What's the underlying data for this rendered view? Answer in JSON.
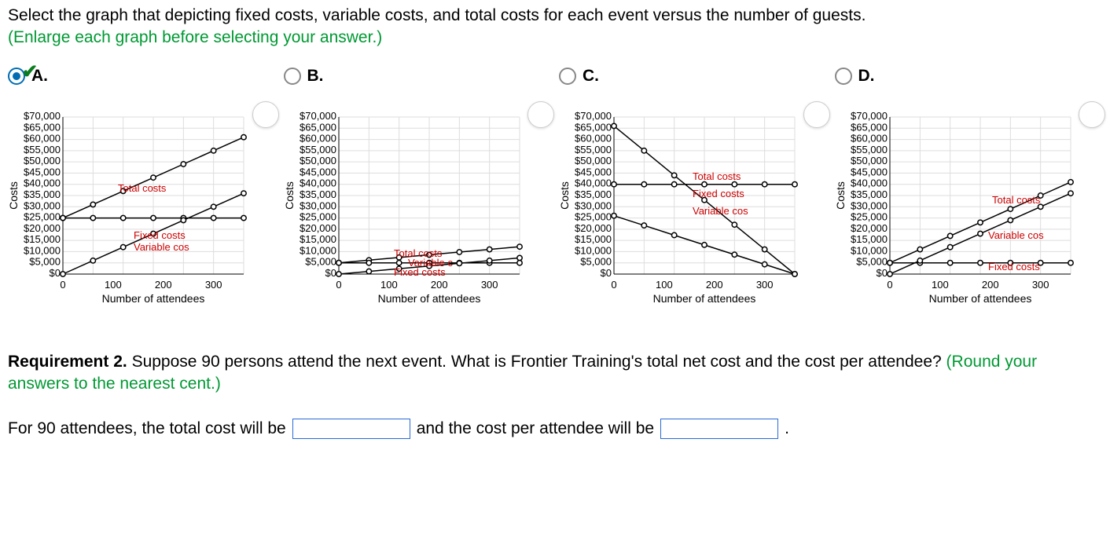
{
  "question": {
    "prompt": "Select the graph that depicting fixed costs, variable costs, and total costs for each event versus the number of guests.",
    "note": "(Enlarge each graph before selecting your answer.)"
  },
  "options": [
    {
      "key": "A",
      "label": "A.",
      "selected": true,
      "correct": true
    },
    {
      "key": "B",
      "label": "B.",
      "selected": false,
      "correct": false
    },
    {
      "key": "C",
      "label": "C.",
      "selected": false,
      "correct": false
    },
    {
      "key": "D",
      "label": "D.",
      "selected": false,
      "correct": false
    }
  ],
  "chart_common": {
    "x_label": "Number of attendees",
    "y_label": "Costs",
    "x_ticks": [
      "0",
      "100",
      "200",
      "300"
    ],
    "y_ticks": [
      "$0",
      "$5,000",
      "$10,000",
      "$15,000",
      "$20,000",
      "$25,000",
      "$30,000",
      "$35,000",
      "$40,000",
      "$45,000",
      "$50,000",
      "$55,000",
      "$60,000",
      "$65,000",
      "$70,000"
    ],
    "y_max": 70000,
    "x_max": 360,
    "x_points": [
      0,
      60,
      120,
      180,
      240,
      300,
      360
    ]
  },
  "chart_data": [
    {
      "type": "line",
      "option": "A",
      "legend": {
        "total": "Total costs",
        "fixed": "Fixed costs",
        "variable": "Variable cos"
      },
      "series": [
        {
          "name": "total",
          "values": [
            25000,
            31000,
            37000,
            43000,
            49000,
            55000,
            61000
          ]
        },
        {
          "name": "fixed",
          "values": [
            25000,
            25000,
            25000,
            25000,
            25000,
            25000,
            25000
          ]
        },
        {
          "name": "variable",
          "values": [
            0,
            6000,
            12000,
            18000,
            24000,
            30000,
            36000
          ]
        }
      ],
      "legend_pos": {
        "total": [
          130,
          95
        ],
        "fixed": [
          150,
          155
        ],
        "variable": [
          150,
          170
        ]
      }
    },
    {
      "type": "line",
      "option": "B",
      "legend": {
        "total": "Total costs",
        "fixed": "Fixed costs",
        "variable": "Variable c"
      },
      "series": [
        {
          "name": "total",
          "values": [
            5000,
            6200,
            7400,
            8600,
            9800,
            11000,
            12200
          ]
        },
        {
          "name": "fixed",
          "values": [
            5000,
            5000,
            5000,
            5000,
            5000,
            5000,
            5000
          ]
        },
        {
          "name": "variable",
          "values": [
            0,
            1200,
            2400,
            3600,
            4800,
            6000,
            7200
          ]
        }
      ],
      "legend_pos": {
        "total": [
          130,
          178
        ],
        "variable": [
          148,
          190
        ],
        "fixed": [
          130,
          202
        ]
      }
    },
    {
      "type": "line",
      "option": "C",
      "legend": {
        "total": "Total costs",
        "fixed": "Fixed costs",
        "variable": "Variable cos"
      },
      "series": [
        {
          "name": "total",
          "values": [
            66000,
            55000,
            44000,
            33000,
            22000,
            11000,
            0
          ]
        },
        {
          "name": "fixed",
          "values": [
            40000,
            40000,
            40000,
            40000,
            40000,
            40000,
            40000
          ]
        },
        {
          "name": "variable",
          "values": [
            26000,
            21667,
            17333,
            13000,
            8667,
            4333,
            0
          ]
        }
      ],
      "legend_pos": {
        "total": [
          160,
          80
        ],
        "fixed": [
          160,
          102
        ],
        "variable": [
          160,
          124
        ]
      }
    },
    {
      "type": "line",
      "option": "D",
      "legend": {
        "total": "Total costs",
        "fixed": "Fixed costs",
        "variable": "Variable cos"
      },
      "series": [
        {
          "name": "fixed",
          "values": [
            5000,
            5000,
            5000,
            5000,
            5000,
            5000,
            5000
          ]
        },
        {
          "name": "variable",
          "values": [
            0,
            6000,
            12000,
            18000,
            24000,
            30000,
            36000
          ]
        },
        {
          "name": "total",
          "values": [
            5000,
            11000,
            17000,
            23000,
            29000,
            35000,
            41000
          ]
        }
      ],
      "legend_pos": {
        "total": [
          190,
          110
        ],
        "variable": [
          185,
          155
        ],
        "fixed": [
          185,
          195
        ]
      }
    }
  ],
  "requirement2": {
    "label": "Requirement 2.",
    "text": "Suppose 90 persons attend the next event. What is Frontier Training's total net cost and the cost per attendee?",
    "note": "(Round your answers to the nearest cent.)"
  },
  "fillins": {
    "lead": "For 90 attendees, the total cost will be",
    "mid": "and the cost per attendee will be",
    "tail": ".",
    "total_cost": "",
    "cost_per_attendee": ""
  }
}
